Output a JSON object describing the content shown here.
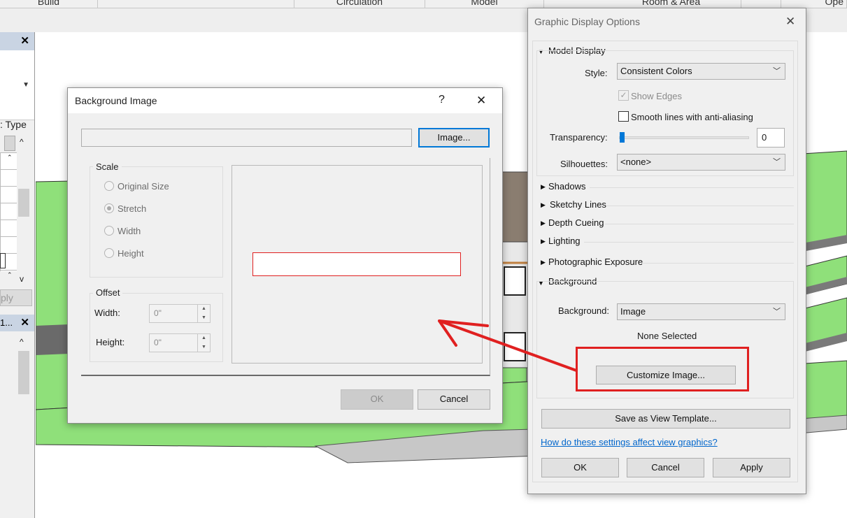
{
  "ribbon": {
    "tabs": [
      "Build",
      "Circulation",
      "Model",
      "Room & Area",
      "Ope"
    ]
  },
  "left_panel": {
    "close_glyph": "✕",
    "type_label": ": Type",
    "apply_label": "ply",
    "tab_label": "1...",
    "close2_glyph": "✕"
  },
  "background_image_dialog": {
    "title": "Background Image",
    "help_glyph": "?",
    "close_glyph": "✕",
    "path_value": "",
    "image_button": "Image...",
    "scale": {
      "title": "Scale",
      "options": [
        "Original Size",
        "Stretch",
        "Width",
        "Height"
      ],
      "selected": "Stretch"
    },
    "offset": {
      "title": "Offset",
      "width_label": "Width:",
      "width_value": "0\"",
      "height_label": "Height:",
      "height_value": "0\""
    },
    "ok_button": "OK",
    "cancel_button": "Cancel"
  },
  "graphic_display_options": {
    "title": "Graphic Display Options",
    "close_glyph": "✕",
    "model_display": {
      "header": "Model Display",
      "style_label": "Style:",
      "style_value": "Consistent Colors",
      "show_edges_label": "Show Edges",
      "show_edges_checked": true,
      "smooth_lines_label": "Smooth lines with anti-aliasing",
      "smooth_lines_checked": false,
      "transparency_label": "Transparency:",
      "transparency_value": "0",
      "silhouettes_label": "Silhouettes:",
      "silhouettes_value": "<none>"
    },
    "collapsed_sections": [
      "Shadows",
      "Sketchy Lines",
      "Depth Cueing",
      "Lighting",
      "Photographic Exposure"
    ],
    "background": {
      "header": "Background",
      "background_label": "Background:",
      "background_value": "Image",
      "status_text": "None Selected",
      "customize_button": "Customize Image..."
    },
    "save_template_button": "Save as View Template...",
    "help_link": "How do these settings affect view graphics?",
    "ok_button": "OK",
    "cancel_button": "Cancel",
    "apply_button": "Apply"
  },
  "colors": {
    "annotation_red": "#e02020",
    "site_green": "#8fe07a",
    "accent_blue": "#0078d7"
  }
}
